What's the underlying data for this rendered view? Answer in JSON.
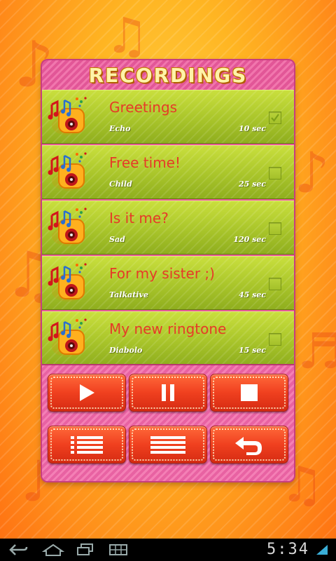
{
  "app": {
    "title": "RECORDINGS",
    "accent_color": "#e63a28",
    "panel_color": "#e85a9a",
    "row_color": "#a9c52a"
  },
  "recordings": [
    {
      "title": "Greetings",
      "style": "Echo",
      "duration": "10 sec",
      "checked": true,
      "icon": "music-box-icon"
    },
    {
      "title": "Free time!",
      "style": "Child",
      "duration": "25 sec",
      "checked": false,
      "icon": "music-box-icon"
    },
    {
      "title": "Is it me?",
      "style": "Sad",
      "duration": "120 sec",
      "checked": false,
      "icon": "music-box-icon"
    },
    {
      "title": "For my sister ;)",
      "style": "Talkative",
      "duration": "45 sec",
      "checked": false,
      "icon": "music-box-icon"
    },
    {
      "title": "My new ringtone",
      "style": "Diabolo",
      "duration": "15 sec",
      "checked": false,
      "icon": "music-box-icon"
    }
  ],
  "controls": {
    "buttons": [
      {
        "name": "play-button",
        "icon": "play-icon"
      },
      {
        "name": "pause-button",
        "icon": "pause-icon"
      },
      {
        "name": "stop-button",
        "icon": "stop-icon"
      },
      {
        "name": "list-button",
        "icon": "list-icon"
      },
      {
        "name": "menu-button",
        "icon": "menu-lines-icon"
      },
      {
        "name": "back-button",
        "icon": "return-icon"
      }
    ]
  },
  "system_bar": {
    "time": "5:34",
    "nav_icons": [
      "back-icon",
      "home-icon",
      "recent-apps-icon",
      "keyboard-icon"
    ]
  }
}
